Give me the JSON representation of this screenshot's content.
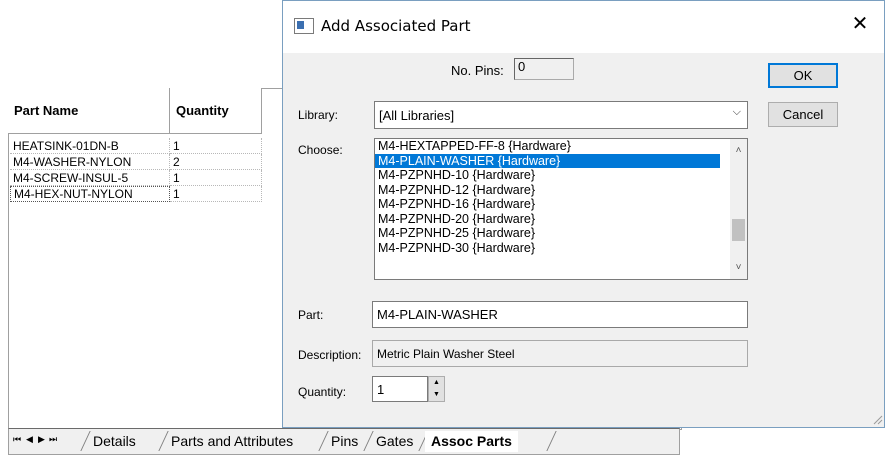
{
  "parts_table": {
    "headers": {
      "name": "Part Name",
      "qty": "Quantity"
    },
    "rows": [
      {
        "name": "HEATSINK-01DN-B",
        "qty": "1"
      },
      {
        "name": "M4-WASHER-NYLON",
        "qty": "2"
      },
      {
        "name": "M4-SCREW-INSUL-5",
        "qty": "1"
      },
      {
        "name": "M4-HEX-NUT-NYLON",
        "qty": "1"
      }
    ]
  },
  "tabs": {
    "nav": [
      "⏮",
      "◀",
      "▶",
      "⏭"
    ],
    "items": [
      "Details",
      "Parts and Attributes",
      "Pins",
      "Gates",
      "Assoc Parts"
    ],
    "active": "Assoc Parts"
  },
  "dialog": {
    "title": "Add Associated Part",
    "close": "✕",
    "no_pins_label": "No. Pins:",
    "no_pins_value": "0",
    "library_label": "Library:",
    "library_value": "[All Libraries]",
    "choose_label": "Choose:",
    "choose_items": [
      "M4-HEXTAPPED-FF-8 {Hardware}",
      "M4-PLAIN-WASHER {Hardware}",
      "M4-PZPNHD-10 {Hardware}",
      "M4-PZPNHD-12 {Hardware}",
      "M4-PZPNHD-16 {Hardware}",
      "M4-PZPNHD-20 {Hardware}",
      "M4-PZPNHD-25 {Hardware}",
      "M4-PZPNHD-30 {Hardware}"
    ],
    "selected_index": 1,
    "part_label": "Part:",
    "part_value": "M4-PLAIN-WASHER",
    "description_label": "Description:",
    "description_value": "Metric Plain Washer Steel",
    "quantity_label": "Quantity:",
    "quantity_value": "1",
    "ok_label": "OK",
    "cancel_label": "Cancel"
  },
  "colors": {
    "selection": "#0078d7",
    "dialog_bg": "#f0f0f0",
    "default_button_border": "#0078d7"
  },
  "icons": {
    "app": "dialog-app-icon",
    "close": "close-icon",
    "dropdown": "chevron-down-icon"
  }
}
